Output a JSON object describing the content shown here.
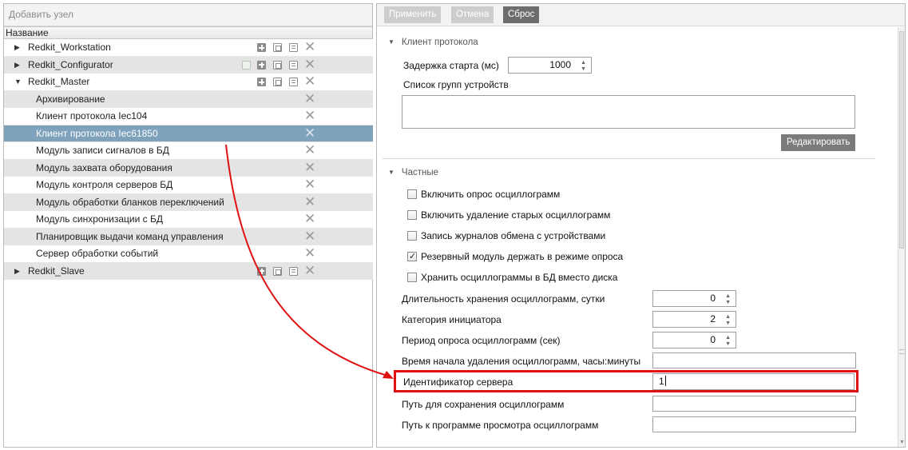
{
  "left": {
    "toolbar": {
      "add_node": "Добавить узел"
    },
    "column_header": "Название",
    "rows": [
      {
        "label": "Redkit_Workstation",
        "expander": "▶"
      },
      {
        "label": "Redkit_Configurator",
        "expander": "▶"
      },
      {
        "label": "Redkit_Master",
        "expander": "▼"
      },
      {
        "label": "Архивирование"
      },
      {
        "label": "Клиент протокола Iec104"
      },
      {
        "label": "Клиент протокола Iec61850"
      },
      {
        "label": "Модуль записи сигналов в БД"
      },
      {
        "label": "Модуль захвата оборудования"
      },
      {
        "label": "Модуль контроля серверов БД"
      },
      {
        "label": "Модуль обработки бланков переключений"
      },
      {
        "label": "Модуль синхронизации с БД"
      },
      {
        "label": "Планировщик выдачи команд управления"
      },
      {
        "label": "Сервер обработки событий"
      },
      {
        "label": "Redkit_Slave",
        "expander": "▶"
      }
    ],
    "delete_glyph": "✕"
  },
  "right": {
    "toolbar": {
      "apply": "Применить",
      "cancel": "Отмена",
      "reset": "Сброс"
    },
    "section_protocol": {
      "title": "Клиент протокола",
      "start_delay_label": "Задержка старта (мс)",
      "start_delay_value": "1000",
      "device_groups_label": "Список групп устройств",
      "edit_button": "Редактировать"
    },
    "section_private": {
      "title": "Частные",
      "checkboxes": [
        {
          "label": "Включить опрос осциллограмм",
          "checked": false
        },
        {
          "label": "Включить удаление старых осциллограмм",
          "checked": false
        },
        {
          "label": "Запись журналов обмена с устройствами",
          "checked": false
        },
        {
          "label": "Резервный модуль держать в режиме опроса",
          "checked": true
        },
        {
          "label": "Хранить осциллограммы в БД вместо диска",
          "checked": false
        }
      ],
      "fields": {
        "retention_label": "Длительность хранения осциллограмм, сутки",
        "retention_value": "0",
        "initiator_label": "Категория инициатора",
        "initiator_value": "2",
        "poll_period_label": "Период опроса осциллограмм (сек)",
        "poll_period_value": "0",
        "delete_time_label": "Время начала удаления осциллограмм, часы:минуты",
        "delete_time_value": "",
        "server_id_label": "Идентификатор сервера",
        "server_id_value": "1",
        "save_path_label": "Путь для сохранения осциллограмм",
        "save_path_value": "",
        "viewer_path_label": "Путь к программе просмотра осциллограмм",
        "viewer_path_value": ""
      }
    }
  },
  "colors": {
    "selected_row": "#7ea2bc",
    "alt_row": "#e4e4e4",
    "highlight_red": "#e01010",
    "reset_button": "#6d6d6d",
    "edit_button": "#7b7b7b"
  },
  "icons": [
    "plus-icon",
    "copy-icon",
    "paste-icon",
    "close-icon",
    "checkbox-icon",
    "spin-up-icon",
    "spin-down-icon",
    "expand-arrow-icon"
  ]
}
